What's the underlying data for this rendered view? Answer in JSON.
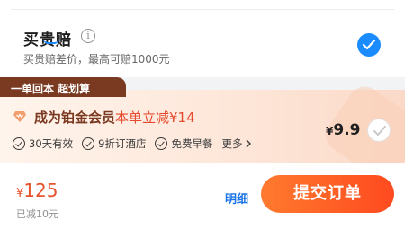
{
  "insurance": {
    "title": "买贵赔",
    "info_icon": "info-icon",
    "description": "买贵赔差价，最高可赔1000元",
    "selected": true,
    "accent_color": "#1a8cff"
  },
  "membership": {
    "tab_label": "一单回本 超划算",
    "title": "成为铂金会员",
    "highlight": "本单立减¥14",
    "perks": [
      "30天有效",
      "9折订酒店",
      "免费早餐"
    ],
    "more_label": "更多",
    "price_currency": "¥",
    "price_value": "9.9",
    "selected": false,
    "accent_color": "#e64a2e"
  },
  "footer": {
    "total_currency": "¥",
    "total_value": "125",
    "reduced_text": "已减10元",
    "detail_label": "明细",
    "submit_label": "提交订单",
    "submit_color": "#ff5a23"
  }
}
